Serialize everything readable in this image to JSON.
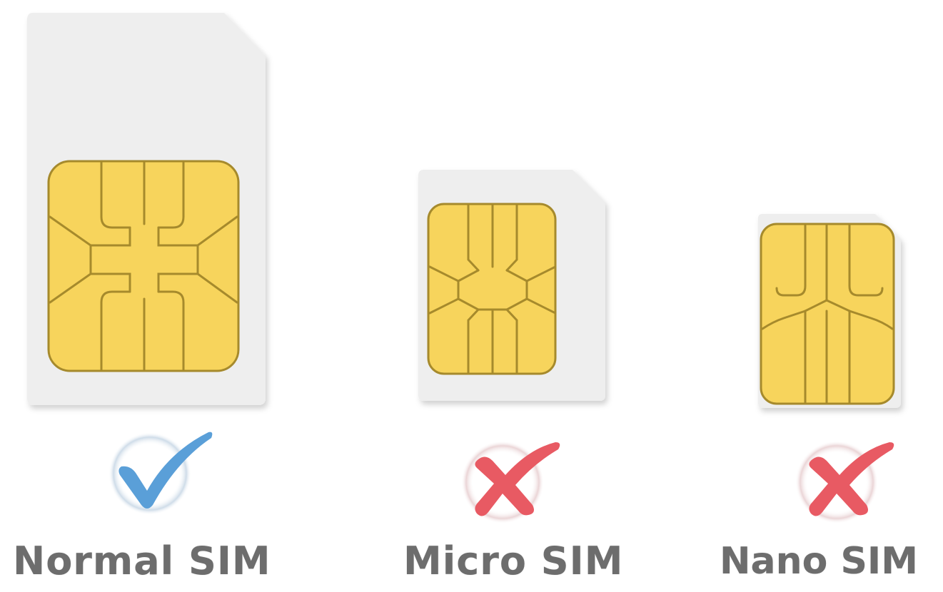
{
  "colors": {
    "card_fill": "#eeeeee",
    "chip_fill": "#f7d45c",
    "chip_line": "#a68a2c",
    "check": "#5a9fd8",
    "cross": "#e85a63",
    "label": "#6d6d6d"
  },
  "sims": [
    {
      "label": "Normal SIM",
      "status": "check-icon"
    },
    {
      "label": "Micro SIM",
      "status": "cross-icon"
    },
    {
      "label": "Nano SIM",
      "status": "cross-icon"
    }
  ]
}
